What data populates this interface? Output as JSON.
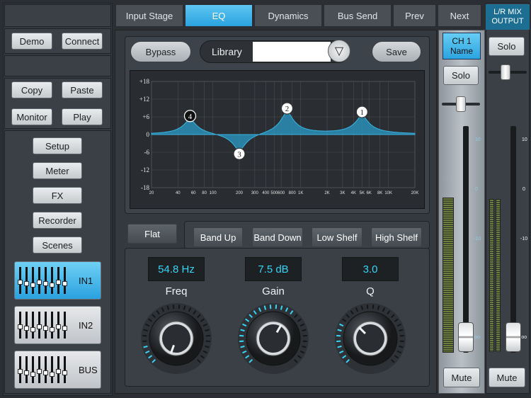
{
  "left": {
    "demo": "Demo",
    "connect": "Connect",
    "copy": "Copy",
    "paste": "Paste",
    "monitor": "Monitor",
    "play": "Play",
    "nav": [
      "Setup",
      "Meter",
      "FX",
      "Recorder",
      "Scenes"
    ],
    "channels": [
      {
        "label": "IN1",
        "active": true
      },
      {
        "label": "IN2",
        "active": false
      },
      {
        "label": "BUS",
        "active": false
      }
    ]
  },
  "tabs": [
    {
      "label": "Input Stage",
      "active": false
    },
    {
      "label": "EQ",
      "active": true
    },
    {
      "label": "Dynamics",
      "active": false
    },
    {
      "label": "Bus Send",
      "active": false
    },
    {
      "label": "Prev",
      "active": false
    },
    {
      "label": "Next",
      "active": false
    }
  ],
  "eq": {
    "bypass": "Bypass",
    "library": "Library",
    "library_value": "",
    "save": "Save",
    "db_ticks": [
      "+18",
      "+12",
      "+6",
      "0",
      "-6",
      "-12",
      "-18"
    ],
    "freq_ticks": [
      "20",
      "40",
      "60",
      "80",
      "100",
      "200",
      "300",
      "400",
      "500",
      "600",
      "800",
      "1K",
      "2K",
      "3K",
      "4K",
      "5K",
      "6K",
      "8K",
      "10K",
      "20K"
    ],
    "bands": [
      {
        "num": "1",
        "freq_hz": 5000,
        "gain_db": 6.5
      },
      {
        "num": "2",
        "freq_hz": 700,
        "gain_db": 8
      },
      {
        "num": "3",
        "freq_hz": 200,
        "gain_db": -6.5
      },
      {
        "num": "4",
        "freq_hz": 55,
        "gain_db": 5.5
      }
    ],
    "flat": "Flat",
    "band_up": "Band Up",
    "band_down": "Band Down",
    "low_shelf": "Low Shelf",
    "high_shelf": "High Shelf",
    "freq_value": "54.8 Hz",
    "gain_value": "7.5 dB",
    "q_value": "3.0",
    "freq_label": "Freq",
    "gain_label": "Gain",
    "q_label": "Q"
  },
  "ch": {
    "name": "CH 1\nName",
    "solo": "Solo",
    "mute": "Mute",
    "scale": [
      "10",
      "0",
      "-10",
      "-oo"
    ]
  },
  "main": {
    "name": "L/R MIX\nOUTPUT",
    "solo": "Solo",
    "mute": "Mute",
    "scale": [
      "10",
      "0",
      "-10",
      "-oo"
    ]
  },
  "colors": {
    "accent": "#2aa2df",
    "eq_fill": "#2a8fb6",
    "lcd_text": "#36d4f6"
  }
}
